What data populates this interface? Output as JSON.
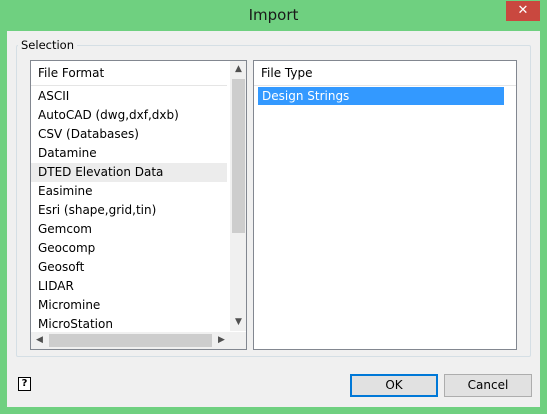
{
  "window": {
    "title": "Import",
    "close_glyph": "✕"
  },
  "selection": {
    "label": "Selection",
    "file_format": {
      "header": "File Format",
      "items": [
        "ASCII",
        "AutoCAD (dwg,dxf,dxb)",
        "CSV (Databases)",
        "Datamine",
        "DTED Elevation Data",
        "Easimine",
        "Esri (shape,grid,tin)",
        "Gemcom",
        "Geocomp",
        "Geosoft",
        "LIDAR",
        "Micromine",
        "MicroStation"
      ],
      "hovered_item": "DTED Elevation Data"
    },
    "file_type": {
      "header": "File Type",
      "items": [
        "Design Strings"
      ],
      "selected": "Design Strings"
    }
  },
  "footer": {
    "help_icon": "?",
    "ok_label": "OK",
    "cancel_label": "Cancel"
  },
  "colors": {
    "title_bar": "#6fd080",
    "close_button": "#c9483f",
    "selection_highlight": "#3399ff"
  }
}
